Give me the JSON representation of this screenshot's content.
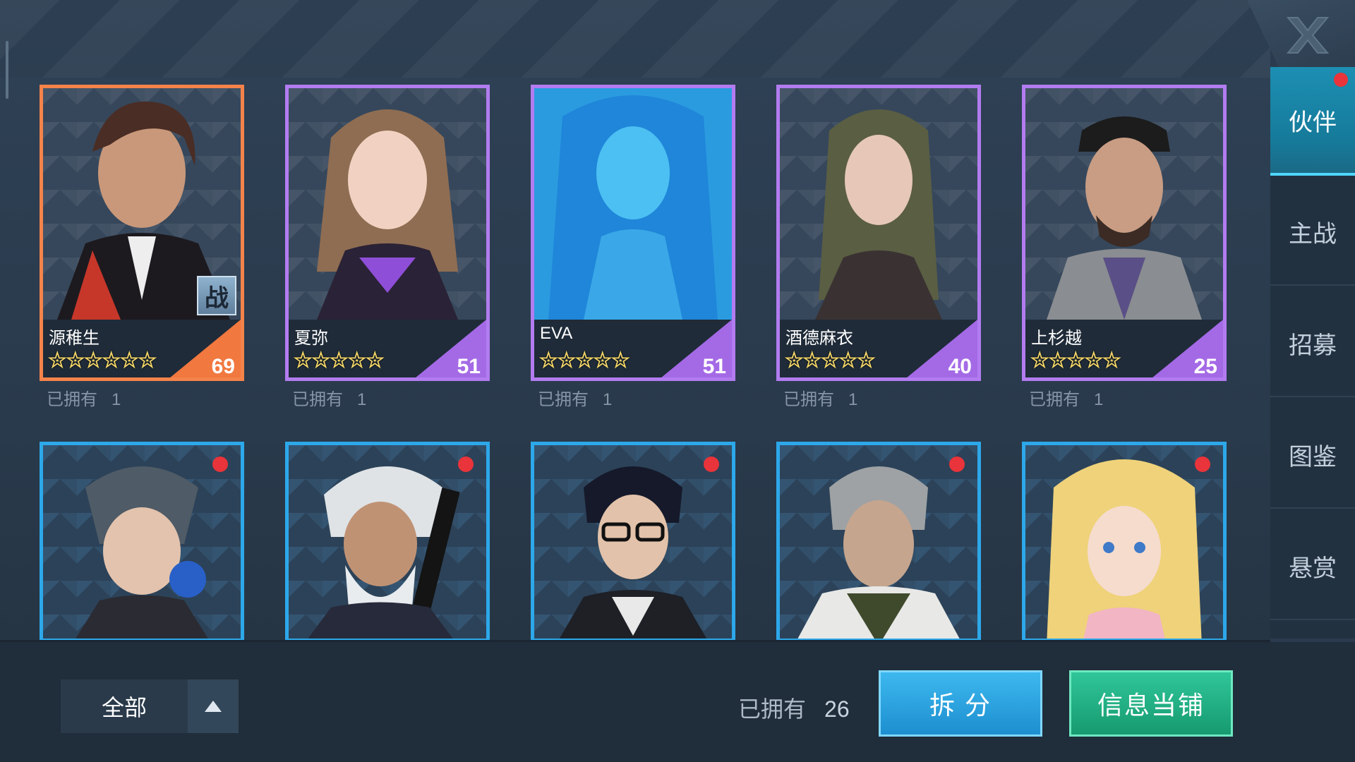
{
  "sidebar": {
    "tabs": [
      {
        "label": "伙伴",
        "active": true,
        "notification": true
      },
      {
        "label": "主战",
        "active": false,
        "notification": false
      },
      {
        "label": "招募",
        "active": false,
        "notification": false
      },
      {
        "label": "图鉴",
        "active": false,
        "notification": false
      },
      {
        "label": "悬赏",
        "active": false,
        "notification": false
      }
    ]
  },
  "close_icon": "close-x-icon",
  "cards_row1": [
    {
      "name": "源稚生",
      "stars": "✮✮✮✮✮✮",
      "level": "69",
      "rarity_color": "#f4834a",
      "badge": "战",
      "owned_label": "已拥有",
      "owned_count": "1"
    },
    {
      "name": "夏弥",
      "stars": "✮✮✮✮✮",
      "level": "51",
      "rarity_color": "#b27cf0",
      "owned_label": "已拥有",
      "owned_count": "1"
    },
    {
      "name": "EVA",
      "stars": "✮✮✮✮✮",
      "level": "51",
      "rarity_color": "#b27cf0",
      "owned_label": "已拥有",
      "owned_count": "1"
    },
    {
      "name": "酒德麻衣",
      "stars": "✮✮✮✮✮",
      "level": "40",
      "rarity_color": "#b27cf0",
      "owned_label": "已拥有",
      "owned_count": "1"
    },
    {
      "name": "上杉越",
      "stars": "✮✮✮✮✮",
      "level": "25",
      "rarity_color": "#b27cf0",
      "owned_label": "已拥有",
      "owned_count": "1"
    }
  ],
  "cards_row2_notifications": [
    true,
    true,
    true,
    true,
    true
  ],
  "bottom": {
    "filter_label": "全部",
    "owned_label": "已拥有",
    "owned_total": "26",
    "split_button": "拆 分",
    "pawn_button": "信息当铺"
  }
}
